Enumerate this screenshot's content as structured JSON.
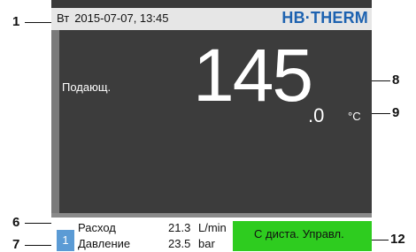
{
  "callouts": {
    "c1": "1",
    "c6": "6",
    "c7": "7",
    "c8": "8",
    "c9": "9",
    "c12": "12"
  },
  "header": {
    "day": "Вт",
    "datetime": "2015-07-07, 13:45",
    "logo": "HB·THERM"
  },
  "main": {
    "zone_label": "Подающ.",
    "temperature_int": "145",
    "temperature_dec": ".0",
    "unit": "°C"
  },
  "bottom": {
    "badge": "1",
    "rows": [
      {
        "label": "Расход",
        "value": "21.3",
        "unit": "L/min"
      },
      {
        "label": "Давление",
        "value": "23.5",
        "unit": "bar"
      }
    ],
    "remote_label": "С дистa. Управл."
  },
  "colors": {
    "logo": "#1d62b0",
    "screen_bg": "#3a3a3a",
    "remote_bg": "#2ecc1f",
    "badge_bg": "#5b9bd5"
  }
}
